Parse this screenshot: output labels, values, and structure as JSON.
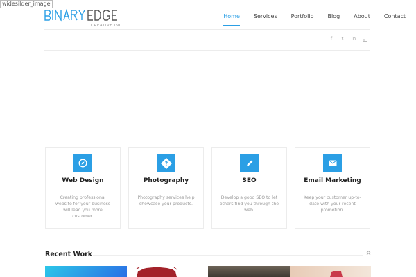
{
  "alt_text": "widesilder_image",
  "logo": {
    "alt": "BINARY EDGE CREATIVE INC."
  },
  "nav": [
    {
      "label": "Home",
      "active": true
    },
    {
      "label": "Services",
      "active": false
    },
    {
      "label": "Portfolio",
      "active": false
    },
    {
      "label": "Blog",
      "active": false
    },
    {
      "label": "About",
      "active": false
    },
    {
      "label": "Contact",
      "active": false
    }
  ],
  "social": [
    "f",
    "t",
    "in",
    "rss"
  ],
  "services": [
    {
      "title": "Web Design",
      "icon": "compass-icon",
      "desc": "Creating professional website for your business will lead you more customer."
    },
    {
      "title": "Photography",
      "icon": "question-tag-icon",
      "desc": "Photography services help showcase your products."
    },
    {
      "title": "SEO",
      "icon": "pencil-icon",
      "desc": "Develop a good SEO to let others find you through the web."
    },
    {
      "title": "Email Marketing",
      "icon": "envelope-icon",
      "desc": "Keep your customer up-to-date with your recent promotion."
    }
  ],
  "recent_work": {
    "title": "Recent Work"
  },
  "colors": {
    "accent": "#2b9fe5"
  }
}
